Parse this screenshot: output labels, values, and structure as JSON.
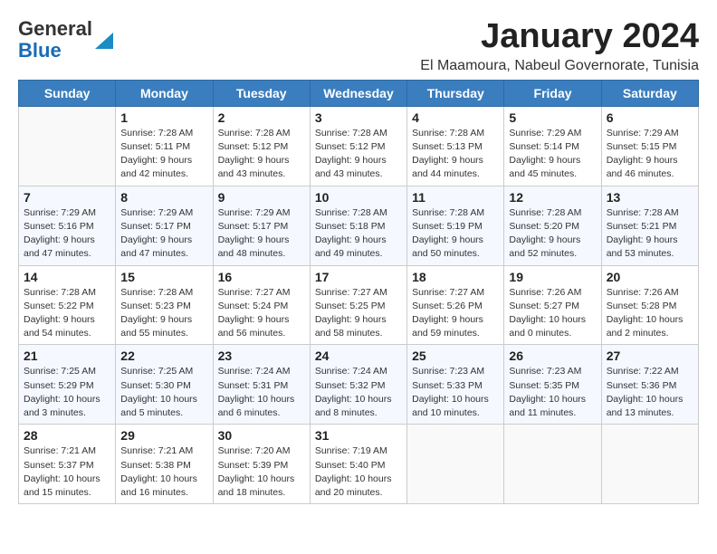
{
  "header": {
    "logo_line1": "General",
    "logo_line2": "Blue",
    "month_title": "January 2024",
    "location": "El Maamoura, Nabeul Governorate, Tunisia"
  },
  "weekdays": [
    "Sunday",
    "Monday",
    "Tuesday",
    "Wednesday",
    "Thursday",
    "Friday",
    "Saturday"
  ],
  "weeks": [
    [
      {
        "day": "",
        "info": ""
      },
      {
        "day": "1",
        "info": "Sunrise: 7:28 AM\nSunset: 5:11 PM\nDaylight: 9 hours\nand 42 minutes."
      },
      {
        "day": "2",
        "info": "Sunrise: 7:28 AM\nSunset: 5:12 PM\nDaylight: 9 hours\nand 43 minutes."
      },
      {
        "day": "3",
        "info": "Sunrise: 7:28 AM\nSunset: 5:12 PM\nDaylight: 9 hours\nand 43 minutes."
      },
      {
        "day": "4",
        "info": "Sunrise: 7:28 AM\nSunset: 5:13 PM\nDaylight: 9 hours\nand 44 minutes."
      },
      {
        "day": "5",
        "info": "Sunrise: 7:29 AM\nSunset: 5:14 PM\nDaylight: 9 hours\nand 45 minutes."
      },
      {
        "day": "6",
        "info": "Sunrise: 7:29 AM\nSunset: 5:15 PM\nDaylight: 9 hours\nand 46 minutes."
      }
    ],
    [
      {
        "day": "7",
        "info": "Sunrise: 7:29 AM\nSunset: 5:16 PM\nDaylight: 9 hours\nand 47 minutes."
      },
      {
        "day": "8",
        "info": "Sunrise: 7:29 AM\nSunset: 5:17 PM\nDaylight: 9 hours\nand 47 minutes."
      },
      {
        "day": "9",
        "info": "Sunrise: 7:29 AM\nSunset: 5:17 PM\nDaylight: 9 hours\nand 48 minutes."
      },
      {
        "day": "10",
        "info": "Sunrise: 7:28 AM\nSunset: 5:18 PM\nDaylight: 9 hours\nand 49 minutes."
      },
      {
        "day": "11",
        "info": "Sunrise: 7:28 AM\nSunset: 5:19 PM\nDaylight: 9 hours\nand 50 minutes."
      },
      {
        "day": "12",
        "info": "Sunrise: 7:28 AM\nSunset: 5:20 PM\nDaylight: 9 hours\nand 52 minutes."
      },
      {
        "day": "13",
        "info": "Sunrise: 7:28 AM\nSunset: 5:21 PM\nDaylight: 9 hours\nand 53 minutes."
      }
    ],
    [
      {
        "day": "14",
        "info": "Sunrise: 7:28 AM\nSunset: 5:22 PM\nDaylight: 9 hours\nand 54 minutes."
      },
      {
        "day": "15",
        "info": "Sunrise: 7:28 AM\nSunset: 5:23 PM\nDaylight: 9 hours\nand 55 minutes."
      },
      {
        "day": "16",
        "info": "Sunrise: 7:27 AM\nSunset: 5:24 PM\nDaylight: 9 hours\nand 56 minutes."
      },
      {
        "day": "17",
        "info": "Sunrise: 7:27 AM\nSunset: 5:25 PM\nDaylight: 9 hours\nand 58 minutes."
      },
      {
        "day": "18",
        "info": "Sunrise: 7:27 AM\nSunset: 5:26 PM\nDaylight: 9 hours\nand 59 minutes."
      },
      {
        "day": "19",
        "info": "Sunrise: 7:26 AM\nSunset: 5:27 PM\nDaylight: 10 hours\nand 0 minutes."
      },
      {
        "day": "20",
        "info": "Sunrise: 7:26 AM\nSunset: 5:28 PM\nDaylight: 10 hours\nand 2 minutes."
      }
    ],
    [
      {
        "day": "21",
        "info": "Sunrise: 7:25 AM\nSunset: 5:29 PM\nDaylight: 10 hours\nand 3 minutes."
      },
      {
        "day": "22",
        "info": "Sunrise: 7:25 AM\nSunset: 5:30 PM\nDaylight: 10 hours\nand 5 minutes."
      },
      {
        "day": "23",
        "info": "Sunrise: 7:24 AM\nSunset: 5:31 PM\nDaylight: 10 hours\nand 6 minutes."
      },
      {
        "day": "24",
        "info": "Sunrise: 7:24 AM\nSunset: 5:32 PM\nDaylight: 10 hours\nand 8 minutes."
      },
      {
        "day": "25",
        "info": "Sunrise: 7:23 AM\nSunset: 5:33 PM\nDaylight: 10 hours\nand 10 minutes."
      },
      {
        "day": "26",
        "info": "Sunrise: 7:23 AM\nSunset: 5:35 PM\nDaylight: 10 hours\nand 11 minutes."
      },
      {
        "day": "27",
        "info": "Sunrise: 7:22 AM\nSunset: 5:36 PM\nDaylight: 10 hours\nand 13 minutes."
      }
    ],
    [
      {
        "day": "28",
        "info": "Sunrise: 7:21 AM\nSunset: 5:37 PM\nDaylight: 10 hours\nand 15 minutes."
      },
      {
        "day": "29",
        "info": "Sunrise: 7:21 AM\nSunset: 5:38 PM\nDaylight: 10 hours\nand 16 minutes."
      },
      {
        "day": "30",
        "info": "Sunrise: 7:20 AM\nSunset: 5:39 PM\nDaylight: 10 hours\nand 18 minutes."
      },
      {
        "day": "31",
        "info": "Sunrise: 7:19 AM\nSunset: 5:40 PM\nDaylight: 10 hours\nand 20 minutes."
      },
      {
        "day": "",
        "info": ""
      },
      {
        "day": "",
        "info": ""
      },
      {
        "day": "",
        "info": ""
      }
    ]
  ]
}
